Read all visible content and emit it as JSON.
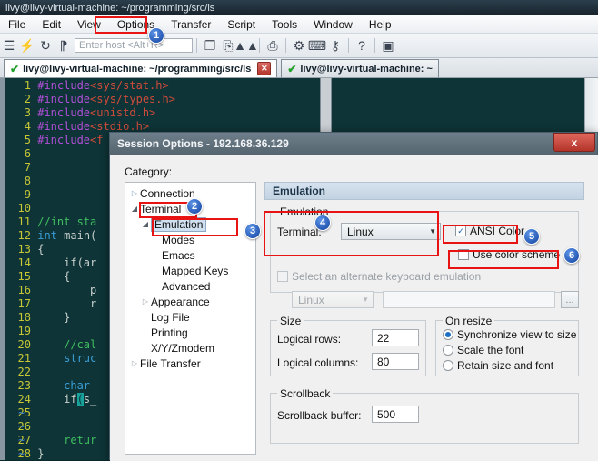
{
  "window": {
    "title": "livy@livy-virtual-machine: ~/programming/src/ls"
  },
  "menubar": {
    "items": [
      {
        "label": "File"
      },
      {
        "label": "Edit"
      },
      {
        "label": "View"
      },
      {
        "label": "Options"
      },
      {
        "label": "Transfer"
      },
      {
        "label": "Script"
      },
      {
        "label": "Tools"
      },
      {
        "label": "Window"
      },
      {
        "label": "Help"
      }
    ]
  },
  "toolbar": {
    "host_placeholder": "Enter host <Alt+R>",
    "icons": [
      {
        "name": "session-manager-icon",
        "glyph": "☰"
      },
      {
        "name": "quick-connect-icon",
        "glyph": "⚡"
      },
      {
        "name": "reconnect-icon",
        "glyph": "↻"
      },
      {
        "name": "disconnect-icon",
        "glyph": "✂"
      },
      {
        "name": "copy-icon",
        "glyph": "❐"
      },
      {
        "name": "paste-icon",
        "glyph": "⎘"
      },
      {
        "name": "find-icon",
        "glyph": "⚲"
      },
      {
        "name": "print-icon",
        "glyph": "⎙"
      },
      {
        "name": "session-options-icon",
        "glyph": "⚙"
      },
      {
        "name": "keyboard-icon",
        "glyph": "⌨"
      },
      {
        "name": "key-icon",
        "glyph": "⚷"
      },
      {
        "name": "help-icon",
        "glyph": "?"
      },
      {
        "name": "secure-desktop-icon",
        "glyph": "▣"
      }
    ]
  },
  "tabs": [
    {
      "label": "livy@livy-virtual-machine: ~/programming/src/ls",
      "active": true
    },
    {
      "label": "livy@livy-virtual-machine: ~",
      "active": false
    }
  ],
  "terminal": {
    "lines": [
      {
        "num": "1",
        "text": "#include<sys/stat.h>"
      },
      {
        "num": "2",
        "text": "#include<sys/types.h>"
      },
      {
        "num": "3",
        "text": "#include<unistd.h>"
      },
      {
        "num": "4",
        "text": "#include<stdio.h>"
      },
      {
        "num": "5",
        "text": "#include<f"
      },
      {
        "num": "6",
        "text": ""
      },
      {
        "num": "7",
        "text": ""
      },
      {
        "num": "8",
        "text": ""
      },
      {
        "num": "9",
        "text": ""
      },
      {
        "num": "10",
        "text": ""
      },
      {
        "num": "11",
        "text": "//int sta"
      },
      {
        "num": "12",
        "text": "int main("
      },
      {
        "num": "13",
        "text": "{"
      },
      {
        "num": "14",
        "text": "    if(ar"
      },
      {
        "num": "15",
        "text": "    {"
      },
      {
        "num": "16",
        "text": "        p"
      },
      {
        "num": "17",
        "text": "        r"
      },
      {
        "num": "18",
        "text": "    }"
      },
      {
        "num": "19",
        "text": ""
      },
      {
        "num": "20",
        "text": "    //cal"
      },
      {
        "num": "21",
        "text": "    struc"
      },
      {
        "num": "22",
        "text": ""
      },
      {
        "num": "23",
        "text": "    char "
      },
      {
        "num": "24",
        "text": "    if(s_"
      },
      {
        "num": "25",
        "text": ""
      },
      {
        "num": "26",
        "text": ""
      },
      {
        "num": "27",
        "text": "    retur"
      },
      {
        "num": "28",
        "text": "}"
      }
    ],
    "empty_markers": [
      "~",
      "~",
      "~",
      "~"
    ]
  },
  "dialog": {
    "title": "Session Options - 192.168.36.129",
    "close_label": "x",
    "category_label": "Category:",
    "tree": [
      {
        "label": "Connection",
        "arrow": "▷",
        "depth": 0,
        "selected": false
      },
      {
        "label": "Terminal",
        "arrow": "◢",
        "depth": 0,
        "selected": false
      },
      {
        "label": "Emulation",
        "arrow": "◢",
        "depth": 1,
        "selected": true
      },
      {
        "label": "Modes",
        "arrow": "",
        "depth": 2,
        "selected": false
      },
      {
        "label": "Emacs",
        "arrow": "",
        "depth": 2,
        "selected": false
      },
      {
        "label": "Mapped Keys",
        "arrow": "",
        "depth": 2,
        "selected": false
      },
      {
        "label": "Advanced",
        "arrow": "",
        "depth": 2,
        "selected": false
      },
      {
        "label": "Appearance",
        "arrow": "▷",
        "depth": 1,
        "selected": false
      },
      {
        "label": "Log File",
        "arrow": "",
        "depth": 2,
        "selected": false
      },
      {
        "label": "Printing",
        "arrow": "",
        "depth": 2,
        "selected": false
      },
      {
        "label": "X/Y/Zmodem",
        "arrow": "",
        "depth": 2,
        "selected": false
      },
      {
        "label": "File Transfer",
        "arrow": "▷",
        "depth": 0,
        "selected": false
      }
    ],
    "panel_header": "Emulation",
    "emulation_group": {
      "legend": "Emulation",
      "terminal_label": "Terminal:",
      "terminal_value": "Linux",
      "ansi_color_label": "ANSI Color",
      "ansi_color_checked": true,
      "use_color_scheme_label": "Use color scheme",
      "use_color_scheme_checked": false,
      "alt_keyboard_label": "Select an alternate keyboard emulation",
      "alt_keyboard_checked": false,
      "alt_keyboard_value": "Linux",
      "alt_keyboard_path": "",
      "browse_label": "..."
    },
    "size_group": {
      "legend": "Size",
      "rows_label": "Logical rows:",
      "rows_value": "22",
      "cols_label": "Logical columns:",
      "cols_value": "80"
    },
    "resize_group": {
      "legend": "On resize",
      "options": [
        {
          "label": "Synchronize view to size",
          "selected": true
        },
        {
          "label": "Scale the font",
          "selected": false
        },
        {
          "label": "Retain size and font",
          "selected": false
        }
      ]
    },
    "scrollback_group": {
      "legend": "Scrollback",
      "buffer_label": "Scrollback buffer:",
      "buffer_value": "500"
    }
  },
  "annotations": [
    {
      "num": "1",
      "target": "options-menu"
    },
    {
      "num": "2",
      "target": "tree-terminal"
    },
    {
      "num": "3",
      "target": "tree-emulation"
    },
    {
      "num": "4",
      "target": "emulation-group"
    },
    {
      "num": "5",
      "target": "ansi-color-checkbox"
    },
    {
      "num": "6",
      "target": "use-color-scheme-checkbox"
    }
  ],
  "colors": {
    "annotation_highlight": "#e81313",
    "badge": "#11429e",
    "terminal_bg": "#0e3437",
    "accent": "#1b6fc4"
  }
}
